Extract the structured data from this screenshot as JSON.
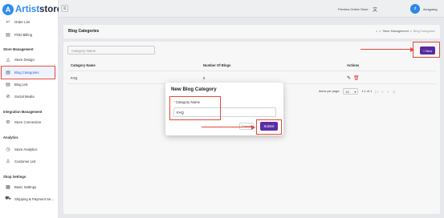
{
  "app": {
    "logo_a": "A",
    "logo_text_1": "Artist",
    "logo_text_2": "store"
  },
  "sidebar": {
    "top_items": [
      {
        "icon": "↩",
        "label": "Order List"
      },
      {
        "icon": "▤",
        "label": "POD Billing"
      }
    ],
    "sections": [
      {
        "title": "Store Management",
        "items": [
          {
            "icon": "◬",
            "label": "Store Design"
          },
          {
            "icon": "▤",
            "label": "Blog Categories",
            "active": true
          },
          {
            "icon": "▤",
            "label": "Blog List"
          },
          {
            "icon": "⊘",
            "label": "Social Media"
          }
        ]
      },
      {
        "title": "Integration Management",
        "items": [
          {
            "icon": "⚙",
            "label": "Store Connection"
          }
        ]
      },
      {
        "title": "Analytics",
        "items": [
          {
            "icon": "◷",
            "label": "Store Analytics"
          },
          {
            "icon": "♙",
            "label": "Customer List"
          }
        ]
      },
      {
        "title": "Shop Settings",
        "items": [
          {
            "icon": "▦",
            "label": "Basic Settings"
          },
          {
            "icon": "⛟",
            "label": "Shipping & Payment Se..."
          }
        ]
      }
    ]
  },
  "topbar": {
    "menu_icon": "≡",
    "preview": "Preview Online Store",
    "lang_icon": "文",
    "avatar_initial": "d",
    "username": "dongyang"
  },
  "header": {
    "title": "Blog Categories",
    "breadcrumb": [
      "Store Management",
      "Blog Categories"
    ],
    "home_icon": "⌂",
    "sep": ">"
  },
  "main": {
    "search_placeholder": "Category Name",
    "new_button": "New",
    "new_plus": "+",
    "columns": [
      "Category Name",
      "Number Of Blogs",
      "Actions"
    ],
    "rows": [
      {
        "name": "FAQ",
        "count": "0"
      }
    ],
    "pager": {
      "label": "Items per page:",
      "per_page": "10",
      "range": "1-1 of 1",
      "caret": "▾",
      "arrows": [
        "|<",
        "<",
        ">",
        ">|"
      ]
    },
    "edit_icon": "✎",
    "delete_icon": "🗑"
  },
  "modal": {
    "title": "New Blog Category",
    "required_mark": "*",
    "field_label": "Category Name",
    "field_value": "FAQ",
    "cancel": "Cancel",
    "submit": "Submit"
  },
  "colors": {
    "accent": "#5b2ea6",
    "brand": "#2d8cf0",
    "highlight": "#e8473c"
  }
}
